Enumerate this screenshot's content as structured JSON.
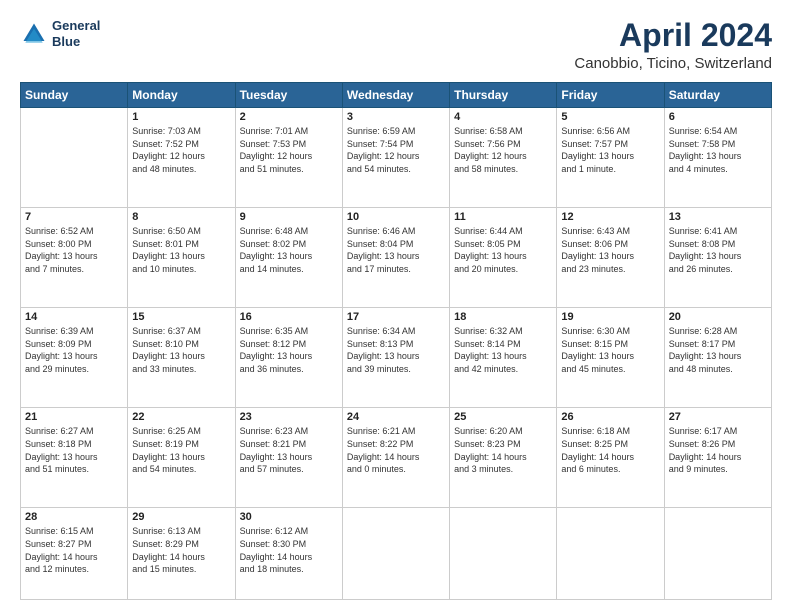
{
  "header": {
    "logo_line1": "General",
    "logo_line2": "Blue",
    "title": "April 2024",
    "subtitle": "Canobbio, Ticino, Switzerland"
  },
  "weekdays": [
    "Sunday",
    "Monday",
    "Tuesday",
    "Wednesday",
    "Thursday",
    "Friday",
    "Saturday"
  ],
  "weeks": [
    [
      {
        "day": "",
        "info": ""
      },
      {
        "day": "1",
        "info": "Sunrise: 7:03 AM\nSunset: 7:52 PM\nDaylight: 12 hours\nand 48 minutes."
      },
      {
        "day": "2",
        "info": "Sunrise: 7:01 AM\nSunset: 7:53 PM\nDaylight: 12 hours\nand 51 minutes."
      },
      {
        "day": "3",
        "info": "Sunrise: 6:59 AM\nSunset: 7:54 PM\nDaylight: 12 hours\nand 54 minutes."
      },
      {
        "day": "4",
        "info": "Sunrise: 6:58 AM\nSunset: 7:56 PM\nDaylight: 12 hours\nand 58 minutes."
      },
      {
        "day": "5",
        "info": "Sunrise: 6:56 AM\nSunset: 7:57 PM\nDaylight: 13 hours\nand 1 minute."
      },
      {
        "day": "6",
        "info": "Sunrise: 6:54 AM\nSunset: 7:58 PM\nDaylight: 13 hours\nand 4 minutes."
      }
    ],
    [
      {
        "day": "7",
        "info": "Sunrise: 6:52 AM\nSunset: 8:00 PM\nDaylight: 13 hours\nand 7 minutes."
      },
      {
        "day": "8",
        "info": "Sunrise: 6:50 AM\nSunset: 8:01 PM\nDaylight: 13 hours\nand 10 minutes."
      },
      {
        "day": "9",
        "info": "Sunrise: 6:48 AM\nSunset: 8:02 PM\nDaylight: 13 hours\nand 14 minutes."
      },
      {
        "day": "10",
        "info": "Sunrise: 6:46 AM\nSunset: 8:04 PM\nDaylight: 13 hours\nand 17 minutes."
      },
      {
        "day": "11",
        "info": "Sunrise: 6:44 AM\nSunset: 8:05 PM\nDaylight: 13 hours\nand 20 minutes."
      },
      {
        "day": "12",
        "info": "Sunrise: 6:43 AM\nSunset: 8:06 PM\nDaylight: 13 hours\nand 23 minutes."
      },
      {
        "day": "13",
        "info": "Sunrise: 6:41 AM\nSunset: 8:08 PM\nDaylight: 13 hours\nand 26 minutes."
      }
    ],
    [
      {
        "day": "14",
        "info": "Sunrise: 6:39 AM\nSunset: 8:09 PM\nDaylight: 13 hours\nand 29 minutes."
      },
      {
        "day": "15",
        "info": "Sunrise: 6:37 AM\nSunset: 8:10 PM\nDaylight: 13 hours\nand 33 minutes."
      },
      {
        "day": "16",
        "info": "Sunrise: 6:35 AM\nSunset: 8:12 PM\nDaylight: 13 hours\nand 36 minutes."
      },
      {
        "day": "17",
        "info": "Sunrise: 6:34 AM\nSunset: 8:13 PM\nDaylight: 13 hours\nand 39 minutes."
      },
      {
        "day": "18",
        "info": "Sunrise: 6:32 AM\nSunset: 8:14 PM\nDaylight: 13 hours\nand 42 minutes."
      },
      {
        "day": "19",
        "info": "Sunrise: 6:30 AM\nSunset: 8:15 PM\nDaylight: 13 hours\nand 45 minutes."
      },
      {
        "day": "20",
        "info": "Sunrise: 6:28 AM\nSunset: 8:17 PM\nDaylight: 13 hours\nand 48 minutes."
      }
    ],
    [
      {
        "day": "21",
        "info": "Sunrise: 6:27 AM\nSunset: 8:18 PM\nDaylight: 13 hours\nand 51 minutes."
      },
      {
        "day": "22",
        "info": "Sunrise: 6:25 AM\nSunset: 8:19 PM\nDaylight: 13 hours\nand 54 minutes."
      },
      {
        "day": "23",
        "info": "Sunrise: 6:23 AM\nSunset: 8:21 PM\nDaylight: 13 hours\nand 57 minutes."
      },
      {
        "day": "24",
        "info": "Sunrise: 6:21 AM\nSunset: 8:22 PM\nDaylight: 14 hours\nand 0 minutes."
      },
      {
        "day": "25",
        "info": "Sunrise: 6:20 AM\nSunset: 8:23 PM\nDaylight: 14 hours\nand 3 minutes."
      },
      {
        "day": "26",
        "info": "Sunrise: 6:18 AM\nSunset: 8:25 PM\nDaylight: 14 hours\nand 6 minutes."
      },
      {
        "day": "27",
        "info": "Sunrise: 6:17 AM\nSunset: 8:26 PM\nDaylight: 14 hours\nand 9 minutes."
      }
    ],
    [
      {
        "day": "28",
        "info": "Sunrise: 6:15 AM\nSunset: 8:27 PM\nDaylight: 14 hours\nand 12 minutes."
      },
      {
        "day": "29",
        "info": "Sunrise: 6:13 AM\nSunset: 8:29 PM\nDaylight: 14 hours\nand 15 minutes."
      },
      {
        "day": "30",
        "info": "Sunrise: 6:12 AM\nSunset: 8:30 PM\nDaylight: 14 hours\nand 18 minutes."
      },
      {
        "day": "",
        "info": ""
      },
      {
        "day": "",
        "info": ""
      },
      {
        "day": "",
        "info": ""
      },
      {
        "day": "",
        "info": ""
      }
    ]
  ]
}
